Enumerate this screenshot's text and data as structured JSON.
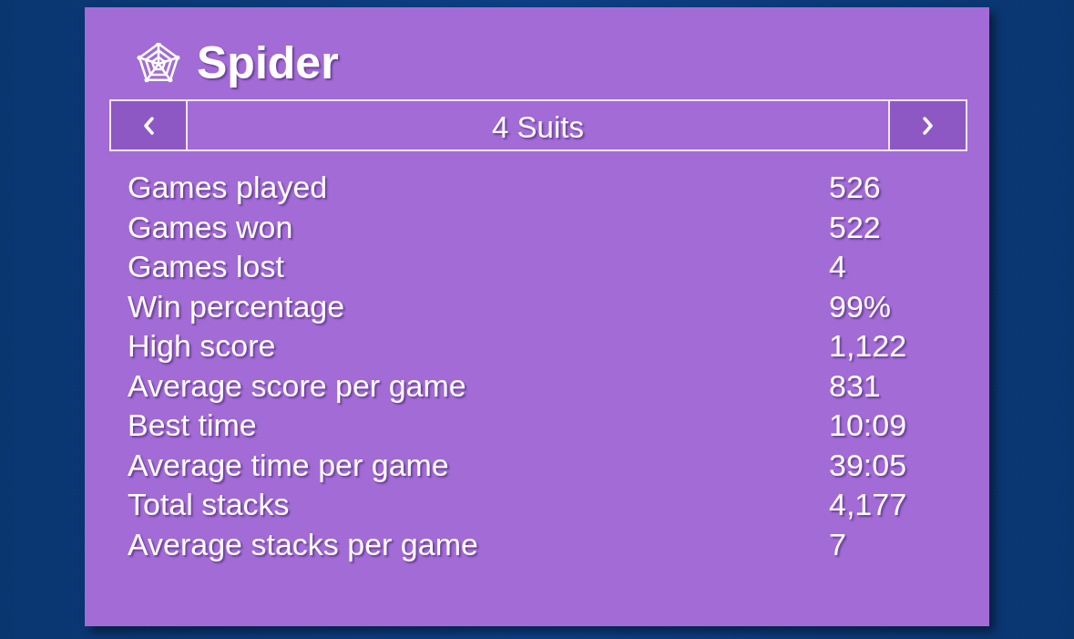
{
  "title": "Spider",
  "selector": {
    "label": "4 Suits"
  },
  "stats": [
    {
      "label": "Games played",
      "value": "526"
    },
    {
      "label": "Games won",
      "value": "522"
    },
    {
      "label": "Games lost",
      "value": "4"
    },
    {
      "label": "Win percentage",
      "value": "99%"
    },
    {
      "label": "High score",
      "value": "1,122"
    },
    {
      "label": "Average score per game",
      "value": "831"
    },
    {
      "label": "Best time",
      "value": "10:09"
    },
    {
      "label": "Average time per game",
      "value": "39:05"
    },
    {
      "label": "Total stacks",
      "value": "4,177"
    },
    {
      "label": "Average stacks per game",
      "value": "7"
    }
  ]
}
